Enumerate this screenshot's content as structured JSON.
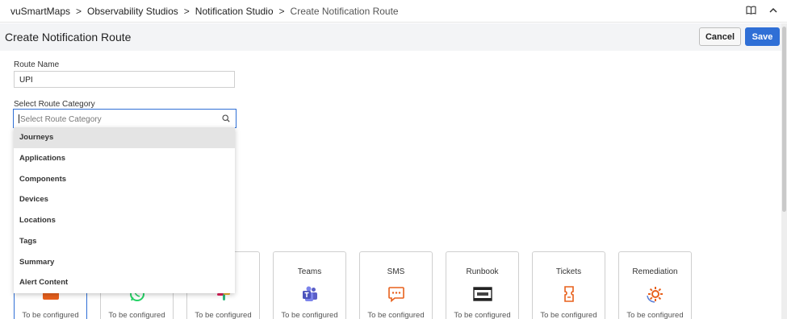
{
  "breadcrumb": {
    "items": [
      "vuSmartMaps",
      "Observability Studios",
      "Notification Studio"
    ],
    "current": "Create Notification Route",
    "separator": ">"
  },
  "header": {
    "title": "Create Notification Route",
    "cancel_label": "Cancel",
    "save_label": "Save"
  },
  "form": {
    "route_name_label": "Route Name",
    "route_name_value": "UPI",
    "category_label": "Select Route Category",
    "category_placeholder": "Select Route Category"
  },
  "dropdown": {
    "options": [
      "Journeys",
      "Applications",
      "Components",
      "Devices",
      "Locations",
      "Tags",
      "Summary",
      "Alert Content"
    ],
    "highlighted": "Journeys"
  },
  "channels": [
    {
      "title": "",
      "status": "To be configured",
      "icon": "email-icon",
      "selected": true
    },
    {
      "title": "",
      "status": "To be configured",
      "icon": "whatsapp-icon",
      "selected": false
    },
    {
      "title": "",
      "status": "To be configured",
      "icon": "slack-icon",
      "selected": false
    },
    {
      "title": "Teams",
      "status": "To be configured",
      "icon": "teams-icon",
      "selected": false
    },
    {
      "title": "SMS",
      "status": "To be configured",
      "icon": "sms-icon",
      "selected": false
    },
    {
      "title": "Runbook",
      "status": "To be configured",
      "icon": "runbook-icon",
      "selected": false
    },
    {
      "title": "Tickets",
      "status": "To be configured",
      "icon": "tickets-icon",
      "selected": false
    },
    {
      "title": "Remediation",
      "status": "To be configured",
      "icon": "remediation-icon",
      "selected": false
    }
  ],
  "colors": {
    "accent": "#2f6fd6",
    "teams": "#5b5fc7",
    "sms": "#e8601c",
    "tickets": "#e8601c",
    "remediation": "#e8601c",
    "whatsapp": "#25d366",
    "email": "#e8601c"
  }
}
